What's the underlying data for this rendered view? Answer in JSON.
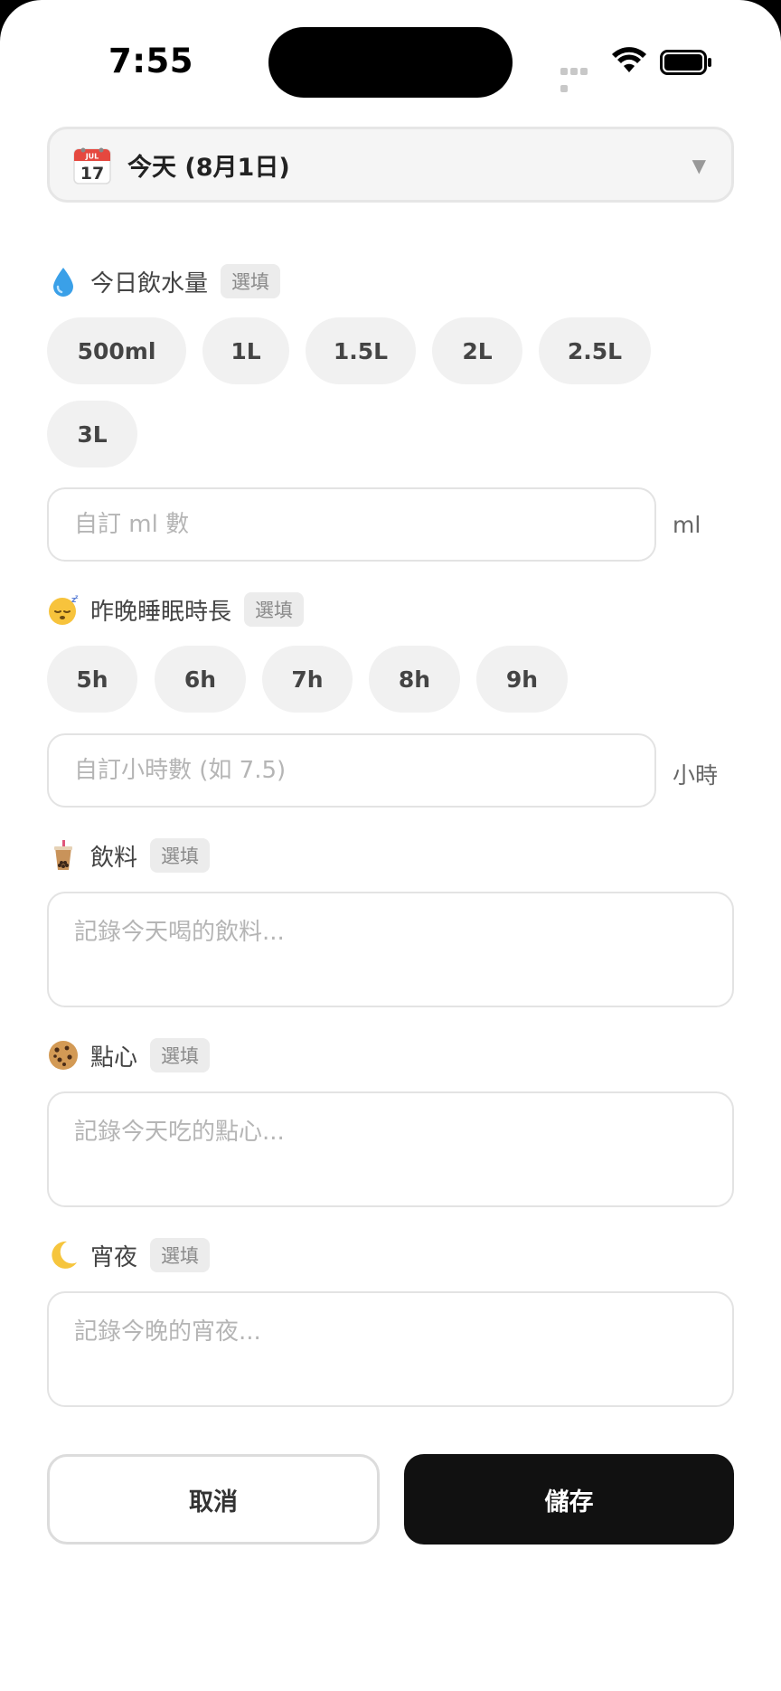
{
  "status_bar": {
    "time": "7:55"
  },
  "date_selector": {
    "calendar_month": "JUL",
    "calendar_day": "17",
    "label": "今天 (8月1日)"
  },
  "optional_badge": "選填",
  "water": {
    "emoji": "droplet-icon",
    "title": "今日飲水量",
    "options": [
      "500ml",
      "1L",
      "1.5L",
      "2L",
      "2.5L",
      "3L"
    ],
    "custom_placeholder": "自訂 ml 數",
    "unit": "ml"
  },
  "sleep": {
    "emoji": "sleeping-face-icon",
    "title": "昨晚睡眠時長",
    "options": [
      "5h",
      "6h",
      "7h",
      "8h",
      "9h"
    ],
    "custom_placeholder": "自訂小時數 (如 7.5)",
    "unit": "小時"
  },
  "drinks": {
    "emoji": "bubble-tea-icon",
    "title": "飲料",
    "placeholder": "記錄今天喝的飲料..."
  },
  "snacks": {
    "emoji": "cookie-icon",
    "title": "點心",
    "placeholder": "記錄今天吃的點心..."
  },
  "late_night": {
    "emoji": "crescent-moon-icon",
    "title": "宵夜",
    "placeholder": "記錄今晚的宵夜..."
  },
  "actions": {
    "cancel": "取消",
    "save": "儲存"
  },
  "colors": {
    "primary_button": "#111111",
    "chip_bg": "#f1f1f1",
    "border": "#e3e3e3"
  }
}
